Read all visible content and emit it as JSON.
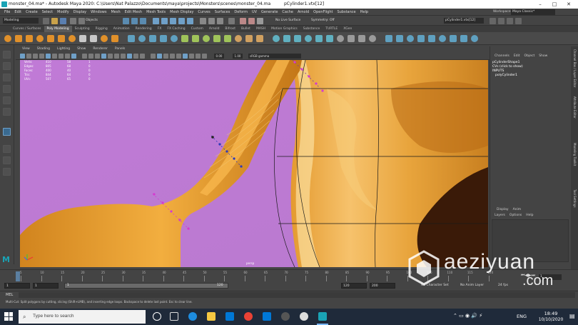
{
  "window": {
    "title_left": "monster_04.ma* - Autodesk Maya 2020: C:\\Users\\Nat Palazzo\\Documents\\maya\\projects\\Monsters\\scenes\\monster_04.ma",
    "title_center": "pCylinder1.vtx[12]",
    "minimize": "–",
    "maximize": "□",
    "close": "✕"
  },
  "menubar": {
    "items": [
      "File",
      "Edit",
      "Create",
      "Select",
      "Modify",
      "Display",
      "Windows",
      "Mesh",
      "Edit Mesh",
      "Mesh Tools",
      "Mesh Display",
      "Curves",
      "Surfaces",
      "Deform",
      "UV",
      "Generate",
      "Cache",
      "Arnold",
      "OpenFlight",
      "Substance",
      "Help"
    ],
    "workspace_label": "Workspace :",
    "workspace_value": "Maya Classic*"
  },
  "statusline": {
    "mode": "Modeling",
    "objects": "Objects",
    "no_live_surface": "No Live Surface",
    "symmetry": "Symmetry: Off",
    "name_field": "pCylinder1.vtx[12]"
  },
  "shelf_tabs": [
    "Curves / Surfaces",
    "Poly Modeling",
    "Sculpting",
    "Rigging",
    "Animation",
    "Rendering",
    "FX",
    "FX Caching",
    "Custom",
    "Arnold",
    "Bifrost",
    "Bullet",
    "MASH",
    "Motion Graphics",
    "Substance",
    "TURTLE",
    "XGen"
  ],
  "shelf_active": "Poly Modeling",
  "panel_menu": [
    "View",
    "Shading",
    "Lighting",
    "Show",
    "Renderer",
    "Panels"
  ],
  "panel_toolbar": {
    "exposure": "0.00",
    "gamma": "1.00",
    "color_space": "sRGB gamma"
  },
  "hud": {
    "rows": [
      {
        "label": "Verts:",
        "a": "410",
        "b": "58",
        "c": "1"
      },
      {
        "label": "Edges:",
        "a": "805",
        "b": "68",
        "c": "0"
      },
      {
        "label": "Faces:",
        "a": "400",
        "b": "40",
        "c": "0"
      },
      {
        "label": "Tris:",
        "a": "844",
        "b": "64",
        "c": "0"
      },
      {
        "label": "UVs:",
        "a": "507",
        "b": "65",
        "c": "0"
      }
    ],
    "camera": "persp"
  },
  "channel_box": {
    "tabs": [
      "Channels",
      "Edit",
      "Object",
      "Show"
    ],
    "object": "pCylinderShape1",
    "cvs": "CVs (click to show)",
    "inputs": "INPUTS",
    "input_node": "polyCylinder1"
  },
  "layer_editor": {
    "tabs": [
      "Display",
      "Anim"
    ],
    "menu": [
      "Layers",
      "Options",
      "Help"
    ]
  },
  "side_tabs": [
    "Channel Box / Layer Editor",
    "Attribute Editor",
    "Modeling Toolkit",
    "Tool Settings"
  ],
  "timeslider": {
    "ticks": [
      "5",
      "10",
      "15",
      "20",
      "25",
      "30",
      "35",
      "40",
      "45",
      "50",
      "55",
      "60",
      "65",
      "70",
      "75",
      "80",
      "85",
      "90",
      "95",
      "100",
      "105",
      "110",
      "115",
      "120"
    ],
    "current_frame": "1"
  },
  "range": {
    "start": "1",
    "start_inner": "1",
    "range_start_label": "1",
    "range_end_label": "120",
    "end_inner": "120",
    "end": "200",
    "no_character_set": "No Character Set",
    "no_anim_layer": "No Anim Layer",
    "fps": "24 fps"
  },
  "mel_label": "MEL",
  "help_line": "Multi-Cut: Split polygons by cutting, slicing (Shift+LMB), and inserting edge loops. Backspace to delete last point. Esc to clear line.",
  "taskbar": {
    "search_placeholder": "Type here to search",
    "language": "ENG",
    "time": "18:49",
    "date": "10/10/2020"
  },
  "watermark": {
    "brand": "aeziyuan",
    "tld": ".com"
  },
  "colors": {
    "viewport_bg": "#c47ad4",
    "mesh": "#e8a23a",
    "accent": "#5285a6",
    "taskbar": "#1f2a3a"
  }
}
